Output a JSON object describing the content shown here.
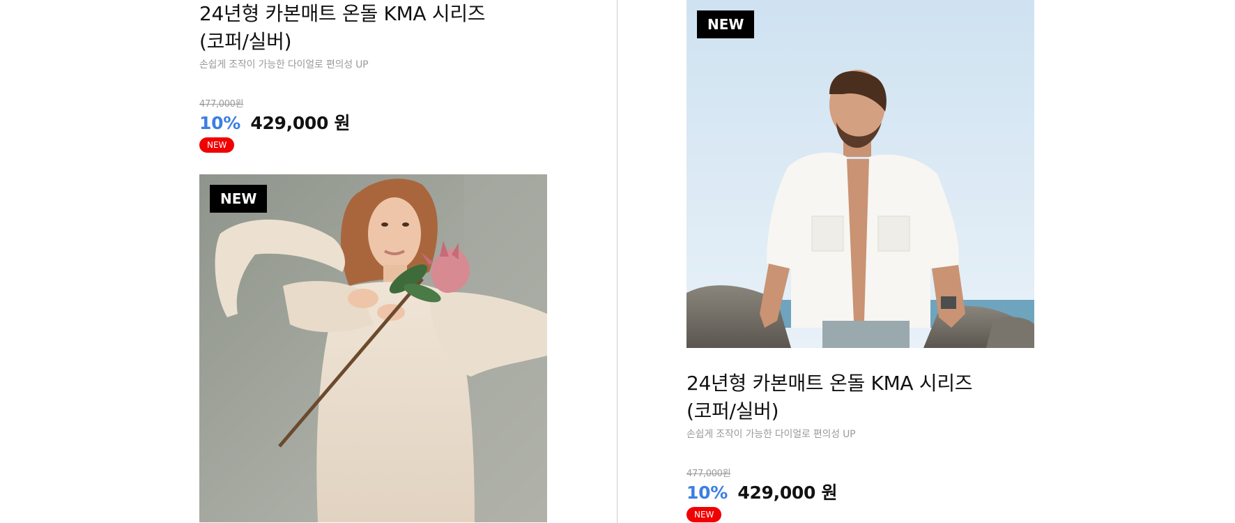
{
  "products": [
    {
      "title_line1": "24년형 카본매트 온돌 KMA 시리즈",
      "title_line2": "(코퍼/실버)",
      "subtitle": "손쉽게 조작이 가능한 다이얼로 편의성 UP",
      "original_price": "477,000원",
      "discount": "10%",
      "sale_price": "429,000 원",
      "badge": "NEW"
    },
    {
      "image_tag": "NEW",
      "image_subject": "woman-in-cream-dress-holding-protea-flower"
    },
    {
      "image_tag": "NEW",
      "image_subject": "man-in-white-shirt-on-beach-rocks",
      "title_line1": "24년형 카본매트 온돌 KMA 시리즈",
      "title_line2": "(코퍼/실버)",
      "subtitle": "손쉽게 조작이 가능한 다이얼로 편의성 UP",
      "original_price": "477,000원",
      "discount": "10%",
      "sale_price": "429,000 원",
      "badge": "NEW"
    }
  ],
  "colors": {
    "discount": "#3b7fe1",
    "badge_bg": "#f00000",
    "tag_bg": "#000000",
    "muted_text": "#9a9a9a"
  }
}
